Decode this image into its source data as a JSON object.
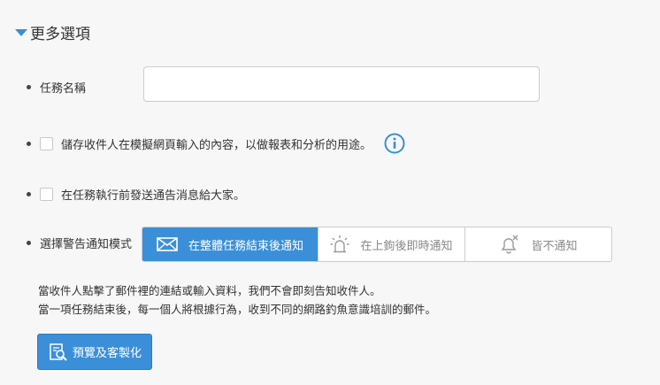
{
  "section": {
    "title": "更多選項"
  },
  "task_name": {
    "label": "任務名稱",
    "value": "",
    "placeholder": ""
  },
  "store_input": {
    "label": "儲存收件人在模擬網頁輸入的內容，以做報表和分析的用途。",
    "checked": false
  },
  "notify_before": {
    "label": "在任務執行前發送通告消息給大家。",
    "checked": false
  },
  "alert_mode": {
    "label": "選擇警告通知模式",
    "options": [
      {
        "label": "在整體任務結束後通知",
        "icon": "envelope-icon",
        "selected": true
      },
      {
        "label": "在上鉤後即時通知",
        "icon": "siren-icon",
        "selected": false
      },
      {
        "label": "皆不通知",
        "icon": "bell-off-icon",
        "selected": false
      }
    ]
  },
  "description": {
    "line1": "當收件人點擊了郵件裡的連結或輸入資料，我們不會即刻告知收件人。",
    "line2": "當一項任務結束後，每一個人將根據行為，收到不同的網路釣魚意識培訓的郵件。"
  },
  "preview_button": {
    "label": "預覽及客製化",
    "icon": "preview-icon"
  },
  "colors": {
    "accent": "#3b8fd9",
    "text": "#333333",
    "muted": "#888888",
    "background": "#f7f7f7"
  }
}
